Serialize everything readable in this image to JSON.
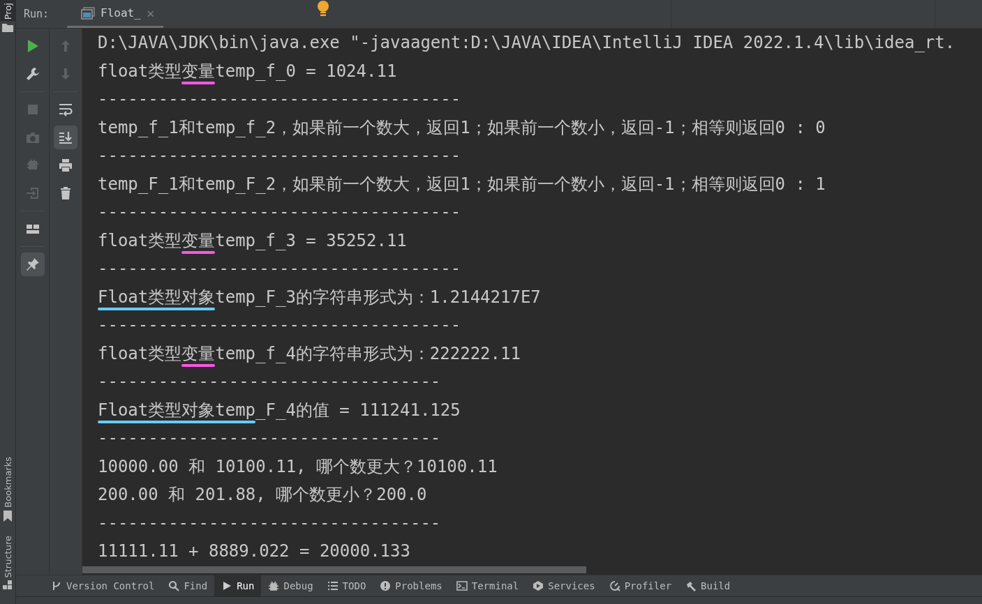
{
  "side_strip": {
    "top_tab": "Proj",
    "bottom_tabs": [
      {
        "label": "Bookmarks",
        "kind": "bookmark"
      },
      {
        "label": "Structure",
        "kind": "structure"
      }
    ]
  },
  "run_bar": {
    "label": "Run:",
    "tab": {
      "title": "Float_",
      "selected": true,
      "close": "×"
    }
  },
  "toolbar_left": [
    {
      "kind": "run",
      "disabled": false,
      "selected": false
    },
    {
      "kind": "wrench",
      "disabled": false,
      "selected": false
    },
    {
      "kind": "sep"
    },
    {
      "kind": "stop",
      "disabled": true,
      "selected": false
    },
    {
      "kind": "camera",
      "disabled": true,
      "selected": false
    },
    {
      "kind": "bug",
      "disabled": true,
      "selected": false
    },
    {
      "kind": "login",
      "disabled": true,
      "selected": false
    },
    {
      "kind": "sep"
    },
    {
      "kind": "layout",
      "disabled": false,
      "selected": false
    },
    {
      "kind": "sep"
    },
    {
      "kind": "pin",
      "disabled": false,
      "selected": true
    }
  ],
  "toolbar_right": [
    {
      "kind": "up",
      "disabled": true,
      "selected": false
    },
    {
      "kind": "down",
      "disabled": true,
      "selected": false
    },
    {
      "kind": "sep"
    },
    {
      "kind": "wrap",
      "disabled": false,
      "selected": false
    },
    {
      "kind": "scrollend",
      "disabled": false,
      "selected": true
    },
    {
      "kind": "print",
      "disabled": false,
      "selected": false
    },
    {
      "kind": "trash",
      "disabled": false,
      "selected": false
    }
  ],
  "console": [
    [
      {
        "text": "D:\\JAVA\\JDK\\bin\\java.exe \"-javaagent:D:\\JAVA\\IDEA\\IntelliJ IDEA 2022.1.4\\lib\\idea_rt."
      }
    ],
    [
      {
        "text": "float类型"
      },
      {
        "text": "变量",
        "color": "#ff55e6"
      },
      {
        "text": "temp_f_0 = 1024.11"
      }
    ],
    [
      {
        "text": "------------------------------------"
      }
    ],
    [
      {
        "text": "temp_f_1和temp_f_2，如果前一个数大，返回1；如果前一个数小，返回-1；相等则返回0 : 0"
      }
    ],
    [
      {
        "text": "------------------------------------"
      }
    ],
    [
      {
        "text": "temp_F_1和temp_F_2，如果前一个数大，返回1；如果前一个数小，返回-1；相等则返回0 : 1"
      }
    ],
    [
      {
        "text": "------------------------------------"
      }
    ],
    [
      {
        "text": "float类型"
      },
      {
        "text": "变量",
        "color": "#ff55e6"
      },
      {
        "text": "temp_f_3 = 35252.11"
      }
    ],
    [
      {
        "text": "------------------------------------"
      }
    ],
    [
      {
        "text": "Float类型对象",
        "color": "#66ccff"
      },
      {
        "text": "temp_F_3的字符串形式为：1.2144217E7"
      }
    ],
    [
      {
        "text": "------------------------------------"
      }
    ],
    [
      {
        "text": "float类型"
      },
      {
        "text": "变量",
        "color": "#ff55e6"
      },
      {
        "text": "temp_f_4的字符串形式为：222222.11"
      }
    ],
    [
      {
        "text": "----------------------------------"
      }
    ],
    [
      {
        "text": "Float类型对象temp",
        "color": "#66ccff"
      },
      {
        "text": "_F_4的值 = 111241.125"
      }
    ],
    [
      {
        "text": "----------------------------------"
      }
    ],
    [
      {
        "text": "10000.00 和 10100.11, 哪个数更大？10100.11"
      }
    ],
    [
      {
        "text": "200.00 和 201.88, 哪个数更小？200.0"
      }
    ],
    [
      {
        "text": "----------------------------------"
      }
    ],
    [
      {
        "text": "11111.11 + 8889.022 = 20000.133"
      }
    ]
  ],
  "bottom_tabs": [
    {
      "label": "Version Control",
      "kind": "vcs",
      "selected": false
    },
    {
      "label": "Find",
      "kind": "find",
      "selected": false
    },
    {
      "label": "Run",
      "kind": "run",
      "selected": true
    },
    {
      "label": "Debug",
      "kind": "debug",
      "selected": false
    },
    {
      "label": "TODO",
      "kind": "todo",
      "selected": false
    },
    {
      "label": "Problems",
      "kind": "problems",
      "selected": false
    },
    {
      "label": "Terminal",
      "kind": "terminal",
      "selected": false
    },
    {
      "label": "Services",
      "kind": "services",
      "selected": false
    },
    {
      "label": "Profiler",
      "kind": "profiler",
      "selected": false
    },
    {
      "label": "Build",
      "kind": "build",
      "selected": false
    }
  ]
}
